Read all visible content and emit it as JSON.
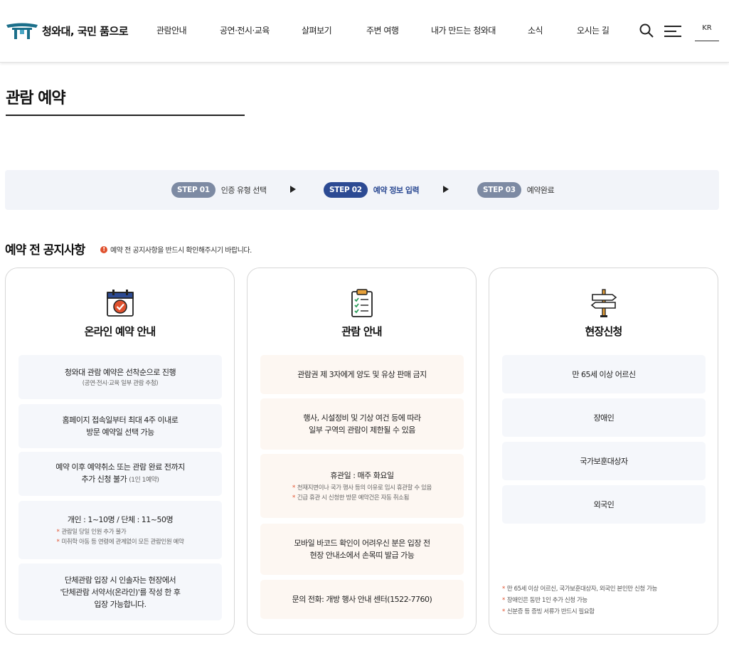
{
  "header": {
    "logo_text": "청와대, 국민 품으로",
    "nav": [
      "관람안내",
      "공연·전시·교육",
      "살펴보기",
      "주변 여행",
      "내가 만드는 청와대",
      "소식",
      "오시는 길"
    ],
    "lang": "KR"
  },
  "page_title": "관람 예약",
  "steps": [
    {
      "badge": "STEP 01",
      "label": "인증 유형 선택",
      "active": false
    },
    {
      "badge": "STEP 02",
      "label": "예약 정보 입력",
      "active": true
    },
    {
      "badge": "STEP 03",
      "label": "예약완료",
      "active": false
    }
  ],
  "notice": {
    "title": "예약 전 공지사항",
    "sub": "예약 전 공지사항을 반드시 확인해주시기 바랍니다.",
    "info_icon": "!"
  },
  "cards": [
    {
      "title": "온라인 예약 안내",
      "icon": "calendar-check-icon",
      "items": [
        {
          "lines": [
            "청와대 관람 예약은 선착순으로 진행"
          ],
          "sub": "(공연·전시·교육 일부 관람 추첨)"
        },
        {
          "lines": [
            "홈페이지 접속일부터 최대 4주 이내로",
            "방문 예약일 선택 가능"
          ]
        },
        {
          "lines": [
            "예약 이후 예약취소 또는 관람 완료 전까지",
            "추가 신청 불가"
          ],
          "small": "(1인 1예약)"
        },
        {
          "lines": [
            "개인 : 1~10명 / 단체 : 11~50명"
          ],
          "bullets": [
            "관람일 당일 인원 추가 불가",
            "미취학 아동 등 연령에 관계없이 모든 관람인원 예약"
          ]
        },
        {
          "lines": [
            "단체관람 입장 시 인솔자는 현장에서",
            "'단체관람 서약서(온라인)'를 작성 한 후",
            "입장 가능합니다."
          ]
        }
      ]
    },
    {
      "title": "관람 안내",
      "icon": "clipboard-check-icon",
      "items": [
        {
          "lines": [
            "관람권 제 3자에게 양도 및 유상 판매 금지"
          ]
        },
        {
          "lines": [
            "행사, 시설정비 및 기상 여건 등에 따라",
            "일부 구역의 관람이 제한될 수 있음"
          ]
        },
        {
          "lines": [
            "휴관일 : 매주 화요일"
          ],
          "bullets": [
            "천재지변이나 국가 행사 등의 이유로 임시 휴관할 수 있음",
            "긴급 휴관 시 신청한 방문 예약건은 자동 취소됨"
          ]
        },
        {
          "lines": [
            "모바일 바코드 확인이 어려우신 분은 입장 전",
            "현장 안내소에서 손목띠 발급 가능"
          ]
        },
        {
          "lines": [
            "문의 전화: 개방 행사 안내 센터(1522-7760)"
          ]
        }
      ]
    },
    {
      "title": "현장신청",
      "icon": "signpost-icon",
      "items": [
        {
          "lines": [
            "만 65세 이상 어르신"
          ]
        },
        {
          "lines": [
            "장애인"
          ]
        },
        {
          "lines": [
            "국가보훈대상자"
          ]
        },
        {
          "lines": [
            "외국인"
          ]
        }
      ],
      "notes": [
        "만 65세 이상 어르신, 국가보훈대상자, 외국인 본인만 신청 가능",
        "장애인은 동반 1인 추가 신청 가능",
        "신분증 등 증빙 서류가 반드시 필요함"
      ]
    }
  ],
  "colors": {
    "step_active": "#2c4a93",
    "step_inactive": "#7d8aa3",
    "accent_red": "#e0512e",
    "logo_teal": "#1b6f8a"
  }
}
